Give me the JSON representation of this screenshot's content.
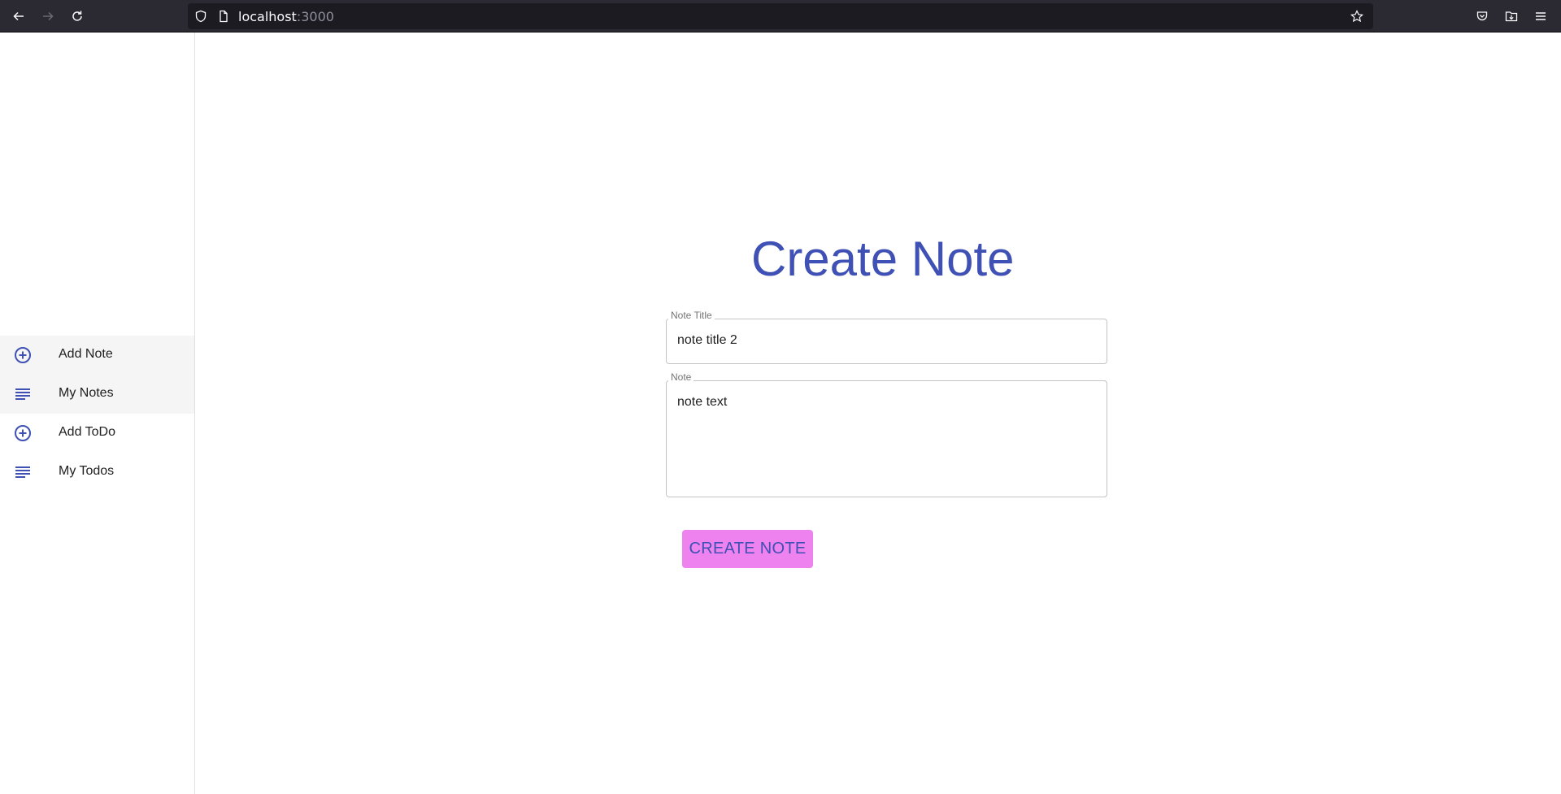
{
  "browser": {
    "url_host": "localhost",
    "url_port": ":3000"
  },
  "sidebar": {
    "items": [
      {
        "label": "Add Note",
        "icon": "add-circle-icon",
        "selected": true
      },
      {
        "label": "My Notes",
        "icon": "list-icon",
        "selected": true
      },
      {
        "label": "Add ToDo",
        "icon": "add-circle-icon",
        "selected": false
      },
      {
        "label": "My Todos",
        "icon": "list-icon",
        "selected": false
      }
    ]
  },
  "main": {
    "title": "Create Note",
    "title_field": {
      "label": "Note Title",
      "value": "note title 2"
    },
    "note_field": {
      "label": "Note",
      "value": "note text"
    },
    "create_button": "CREATE NOTE"
  },
  "colors": {
    "primary": "#3f51b5",
    "button_bg": "#ee82ee",
    "chrome_bg": "#2b2a33"
  }
}
